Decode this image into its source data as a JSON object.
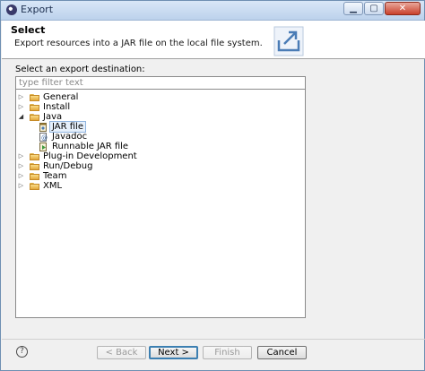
{
  "window": {
    "title": "Export",
    "controls": {
      "minimize": "▁",
      "maximize": "▢",
      "close": "✕"
    }
  },
  "header": {
    "title": "Select",
    "description": "Export resources into a JAR file on the local file system.",
    "icon": "export-wizard-icon"
  },
  "main": {
    "destination_label": "Select an export destination:",
    "filter_placeholder": "type filter text",
    "tree": [
      {
        "label": "General",
        "expanded": false,
        "icon": "folder-icon"
      },
      {
        "label": "Install",
        "expanded": false,
        "icon": "folder-icon"
      },
      {
        "label": "Java",
        "expanded": true,
        "icon": "folder-icon",
        "children": [
          {
            "label": "JAR file",
            "selected": true,
            "icon": "jar-file-icon"
          },
          {
            "label": "Javadoc",
            "icon": "javadoc-icon"
          },
          {
            "label": "Runnable JAR file",
            "icon": "runnable-jar-icon"
          }
        ]
      },
      {
        "label": "Plug-in Development",
        "expanded": false,
        "icon": "folder-icon"
      },
      {
        "label": "Run/Debug",
        "expanded": false,
        "icon": "folder-icon"
      },
      {
        "label": "Team",
        "expanded": false,
        "icon": "folder-icon"
      },
      {
        "label": "XML",
        "expanded": false,
        "icon": "folder-icon"
      }
    ]
  },
  "footer": {
    "help": "?",
    "back": "< Back",
    "next": "Next >",
    "finish": "Finish",
    "cancel": "Cancel"
  }
}
